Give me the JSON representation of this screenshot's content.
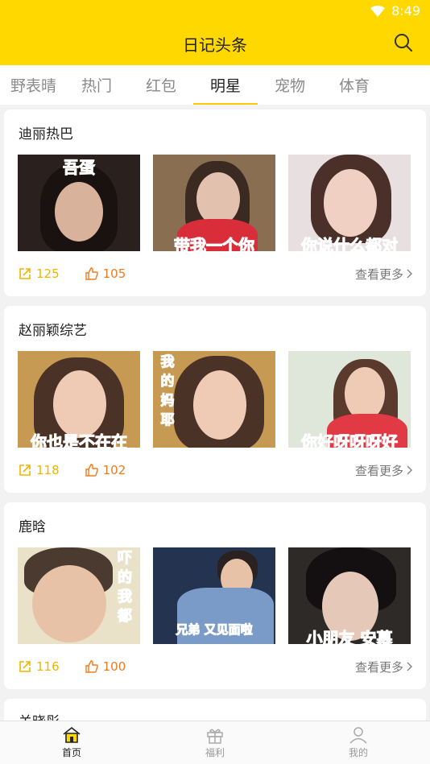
{
  "status": {
    "time": "8:49"
  },
  "header": {
    "title": "日记头条"
  },
  "tabs": [
    {
      "label": "野表晴"
    },
    {
      "label": "热门"
    },
    {
      "label": "红包"
    },
    {
      "label": "明星"
    },
    {
      "label": "宠物"
    },
    {
      "label": "体育"
    }
  ],
  "cards": [
    {
      "title": "迪丽热巴",
      "captions": [
        "吾蛋",
        "带我一个你",
        "你说什么都对"
      ],
      "shares": "125",
      "likes": "105",
      "more": "查看更多"
    },
    {
      "title": "赵丽颖综艺",
      "captions": [
        "你也是不在在",
        "我的妈耶",
        "你好呀呀呀好"
      ],
      "shares": "118",
      "likes": "102",
      "more": "查看更多"
    },
    {
      "title": "鹿晗",
      "captions": [
        "吓的我都",
        "兄弟 又见面啦",
        "小朋友 安慕"
      ],
      "shares": "116",
      "likes": "100",
      "more": "查看更多"
    }
  ],
  "partial_card": {
    "title": "关晓彤"
  },
  "nav": [
    {
      "label": "首页"
    },
    {
      "label": "福利"
    },
    {
      "label": "我的"
    }
  ]
}
